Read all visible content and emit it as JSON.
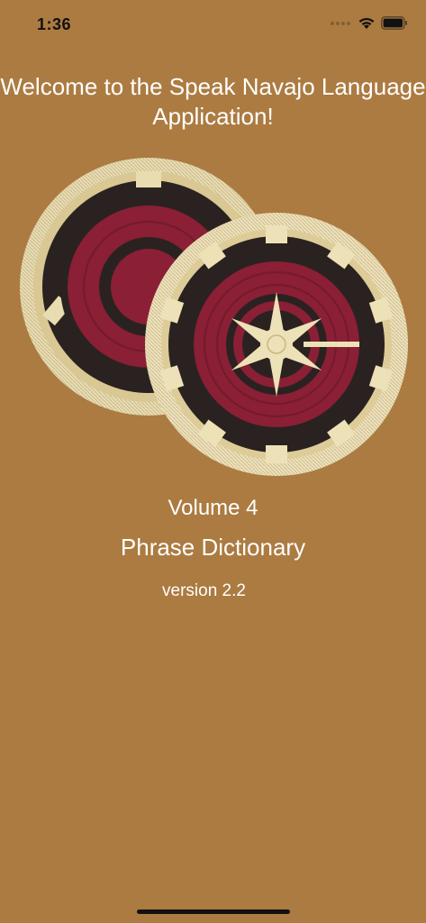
{
  "status_bar": {
    "time": "1:36",
    "icons": [
      "signal-icon",
      "wifi-icon",
      "battery-icon"
    ]
  },
  "welcome_text": "Welcome to the Speak Navajo Language Application!",
  "image": {
    "icon": "navajo-basket-image"
  },
  "volume_label": "Volume 4",
  "subtitle": "Phrase Dictionary",
  "version_label": "version 2.2",
  "colors": {
    "background": "#ac7b41",
    "text": "#ffffff",
    "basket_cream": "#e8dcb0",
    "basket_red": "#8a1f35",
    "basket_black": "#2a2220"
  }
}
